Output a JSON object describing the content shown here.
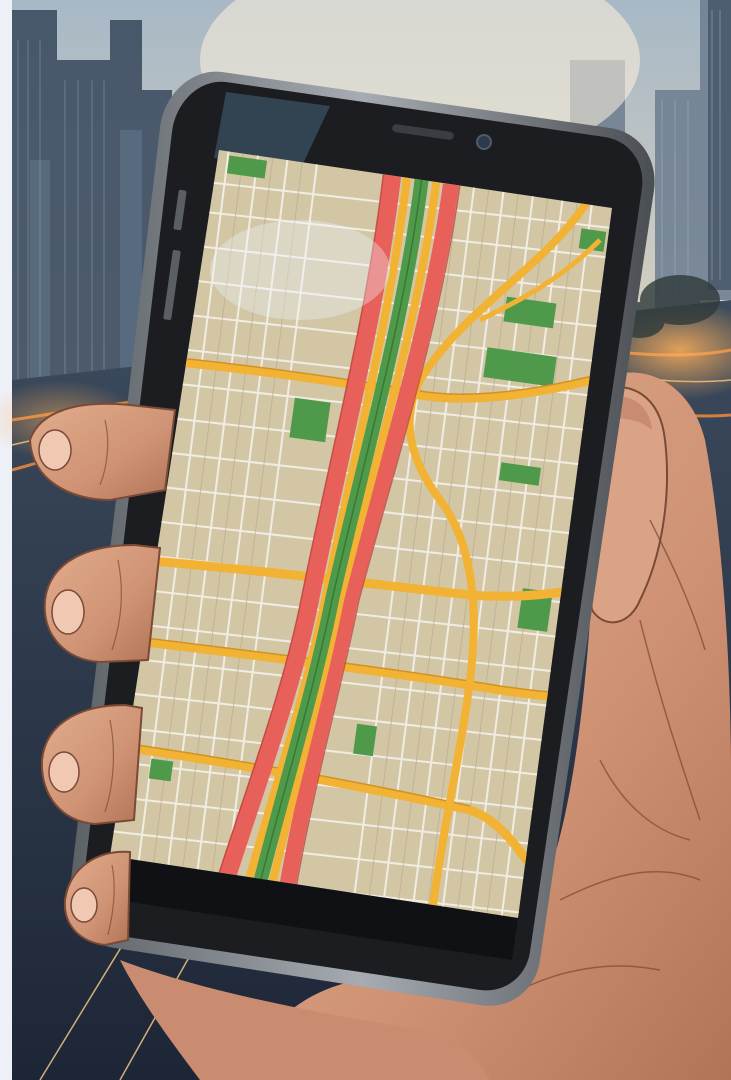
{
  "scene": {
    "subject": "hand-holding-smartphone",
    "screen_content": "city-traffic-map",
    "traffic_colors": {
      "heavy": "#e8605a",
      "moderate": "#f2b233",
      "free_flow": "#4f9a4a"
    },
    "palette": {
      "sky_top": "#9fb1c1",
      "sky_glow": "#e8d6b4",
      "phone_body": "#1b1d20",
      "phone_rim": "#8a9097",
      "map_land": "#d2c6a5",
      "map_streets": "#f4f1ea",
      "park_green": "#4f9a4a",
      "skin": "#d39a7c",
      "skin_shadow": "#a9705a",
      "city_lights": "#f08a3c",
      "page_margin": "#eef0f8"
    },
    "icons": [
      "earpiece-icon",
      "front-camera-icon"
    ]
  }
}
